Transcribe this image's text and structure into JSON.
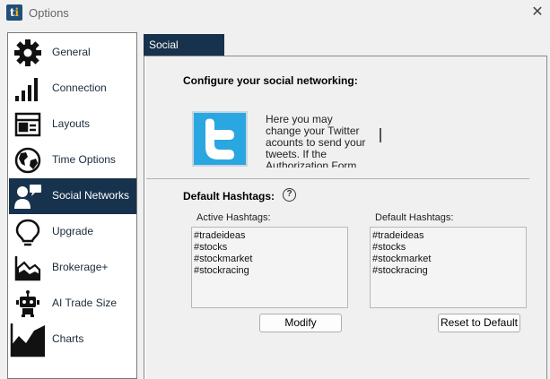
{
  "window": {
    "title": "Options",
    "close_glyph": "✕"
  },
  "sidebar": {
    "items": [
      {
        "label": "General",
        "icon": "gear-icon"
      },
      {
        "label": "Connection",
        "icon": "signal-bars-icon"
      },
      {
        "label": "Layouts",
        "icon": "layout-icon"
      },
      {
        "label": "Time Options",
        "icon": "globe-icon"
      },
      {
        "label": "Social Networks",
        "icon": "social-people-icon",
        "selected": true
      },
      {
        "label": "Upgrade",
        "icon": "lightbulb-icon"
      },
      {
        "label": "Brokerage+",
        "icon": "area-chart-icon"
      },
      {
        "label": "AI Trade Size",
        "icon": "robot-icon"
      },
      {
        "label": "Charts",
        "icon": "chart-icon"
      }
    ]
  },
  "tab": {
    "label": "Social Networks"
  },
  "main": {
    "configure_heading": "Configure your social networking:",
    "twitter_text": "Here you may change your Twitter acounts to send your tweets.  If the Authorization Form shows that you're still",
    "hashtags_heading": "Default Hashtags:",
    "help_glyph": "?",
    "active_label": "Active Hashtags:",
    "default_label": "Default Hashtags:",
    "active_hashtags": [
      "#tradeideas",
      "#stocks",
      "#stockmarket",
      "#stockracing"
    ],
    "default_hashtags": [
      "#tradeideas",
      "#stocks",
      "#stockmarket",
      "#stockracing"
    ],
    "modify_button": "Modify",
    "reset_button": "Reset to Default"
  },
  "colors": {
    "selected_bg": "#17324d",
    "twitter_blue": "#2aa7e0"
  }
}
